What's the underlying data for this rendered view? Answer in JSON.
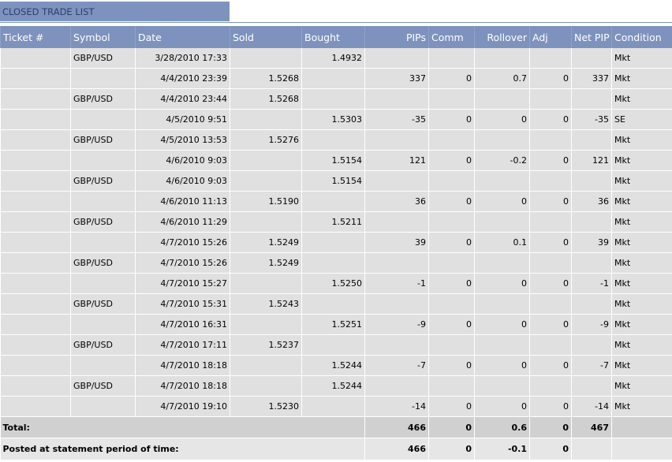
{
  "title": "CLOSED TRADE LIST",
  "columns": [
    "Ticket #",
    "Symbol",
    "Date",
    "Sold",
    "Bought",
    "PIPs",
    "Comm",
    "Rollover",
    "Adj",
    "Net PIP",
    "Condition"
  ],
  "rows": [
    {
      "ticket": "",
      "symbol": "GBP/USD",
      "date": "3/28/2010 17:33",
      "sold": "",
      "bought": "1.4932",
      "pips": "",
      "comm": "",
      "rollover": "",
      "adj": "",
      "net_pip": "",
      "condition": "Mkt"
    },
    {
      "ticket": "",
      "symbol": "",
      "date": "4/4/2010 23:39",
      "sold": "1.5268",
      "bought": "",
      "pips": "337",
      "comm": "0",
      "rollover": "0.7",
      "adj": "0",
      "net_pip": "337",
      "condition": "Mkt"
    },
    {
      "ticket": "",
      "symbol": "GBP/USD",
      "date": "4/4/2010 23:44",
      "sold": "1.5268",
      "bought": "",
      "pips": "",
      "comm": "",
      "rollover": "",
      "adj": "",
      "net_pip": "",
      "condition": "Mkt"
    },
    {
      "ticket": "",
      "symbol": "",
      "date": "4/5/2010 9:51",
      "sold": "",
      "bought": "1.5303",
      "pips": "-35",
      "comm": "0",
      "rollover": "0",
      "adj": "0",
      "net_pip": "-35",
      "condition": "SE"
    },
    {
      "ticket": "",
      "symbol": "GBP/USD",
      "date": "4/5/2010 13:53",
      "sold": "1.5276",
      "bought": "",
      "pips": "",
      "comm": "",
      "rollover": "",
      "adj": "",
      "net_pip": "",
      "condition": "Mkt"
    },
    {
      "ticket": "",
      "symbol": "",
      "date": "4/6/2010 9:03",
      "sold": "",
      "bought": "1.5154",
      "pips": "121",
      "comm": "0",
      "rollover": "-0.2",
      "adj": "0",
      "net_pip": "121",
      "condition": "Mkt"
    },
    {
      "ticket": "",
      "symbol": "GBP/USD",
      "date": "4/6/2010 9:03",
      "sold": "",
      "bought": "1.5154",
      "pips": "",
      "comm": "",
      "rollover": "",
      "adj": "",
      "net_pip": "",
      "condition": "Mkt"
    },
    {
      "ticket": "",
      "symbol": "",
      "date": "4/6/2010 11:13",
      "sold": "1.5190",
      "bought": "",
      "pips": "36",
      "comm": "0",
      "rollover": "0",
      "adj": "0",
      "net_pip": "36",
      "condition": "Mkt"
    },
    {
      "ticket": "",
      "symbol": "GBP/USD",
      "date": "4/6/2010 11:29",
      "sold": "",
      "bought": "1.5211",
      "pips": "",
      "comm": "",
      "rollover": "",
      "adj": "",
      "net_pip": "",
      "condition": "Mkt"
    },
    {
      "ticket": "",
      "symbol": "",
      "date": "4/7/2010 15:26",
      "sold": "1.5249",
      "bought": "",
      "pips": "39",
      "comm": "0",
      "rollover": "0.1",
      "adj": "0",
      "net_pip": "39",
      "condition": "Mkt"
    },
    {
      "ticket": "",
      "symbol": "GBP/USD",
      "date": "4/7/2010 15:26",
      "sold": "1.5249",
      "bought": "",
      "pips": "",
      "comm": "",
      "rollover": "",
      "adj": "",
      "net_pip": "",
      "condition": "Mkt"
    },
    {
      "ticket": "",
      "symbol": "",
      "date": "4/7/2010 15:27",
      "sold": "",
      "bought": "1.5250",
      "pips": "-1",
      "comm": "0",
      "rollover": "0",
      "adj": "0",
      "net_pip": "-1",
      "condition": "Mkt"
    },
    {
      "ticket": "",
      "symbol": "GBP/USD",
      "date": "4/7/2010 15:31",
      "sold": "1.5243",
      "bought": "",
      "pips": "",
      "comm": "",
      "rollover": "",
      "adj": "",
      "net_pip": "",
      "condition": "Mkt"
    },
    {
      "ticket": "",
      "symbol": "",
      "date": "4/7/2010 16:31",
      "sold": "",
      "bought": "1.5251",
      "pips": "-9",
      "comm": "0",
      "rollover": "0",
      "adj": "0",
      "net_pip": "-9",
      "condition": "Mkt"
    },
    {
      "ticket": "",
      "symbol": "GBP/USD",
      "date": "4/7/2010 17:11",
      "sold": "1.5237",
      "bought": "",
      "pips": "",
      "comm": "",
      "rollover": "",
      "adj": "",
      "net_pip": "",
      "condition": "Mkt"
    },
    {
      "ticket": "",
      "symbol": "",
      "date": "4/7/2010 18:18",
      "sold": "",
      "bought": "1.5244",
      "pips": "-7",
      "comm": "0",
      "rollover": "0",
      "adj": "0",
      "net_pip": "-7",
      "condition": "Mkt"
    },
    {
      "ticket": "",
      "symbol": "GBP/USD",
      "date": "4/7/2010 18:18",
      "sold": "",
      "bought": "1.5244",
      "pips": "",
      "comm": "",
      "rollover": "",
      "adj": "",
      "net_pip": "",
      "condition": "Mkt"
    },
    {
      "ticket": "",
      "symbol": "",
      "date": "4/7/2010 19:10",
      "sold": "1.5230",
      "bought": "",
      "pips": "-14",
      "comm": "0",
      "rollover": "0",
      "adj": "0",
      "net_pip": "-14",
      "condition": "Mkt"
    }
  ],
  "total": {
    "label": "Total:",
    "pips": "466",
    "comm": "0",
    "rollover": "0.6",
    "adj": "0",
    "net_pip": "467"
  },
  "posted": {
    "label": "Posted at statement period of time:",
    "pips": "466",
    "comm": "0",
    "rollover": "-0.1",
    "adj": "0",
    "net_pip": ""
  },
  "colors": {
    "header_bg": "#7d93bd",
    "title_text": "#2b3f6e",
    "row_bg": "#e0e0e0",
    "total_bg": "#d0d0d0"
  }
}
